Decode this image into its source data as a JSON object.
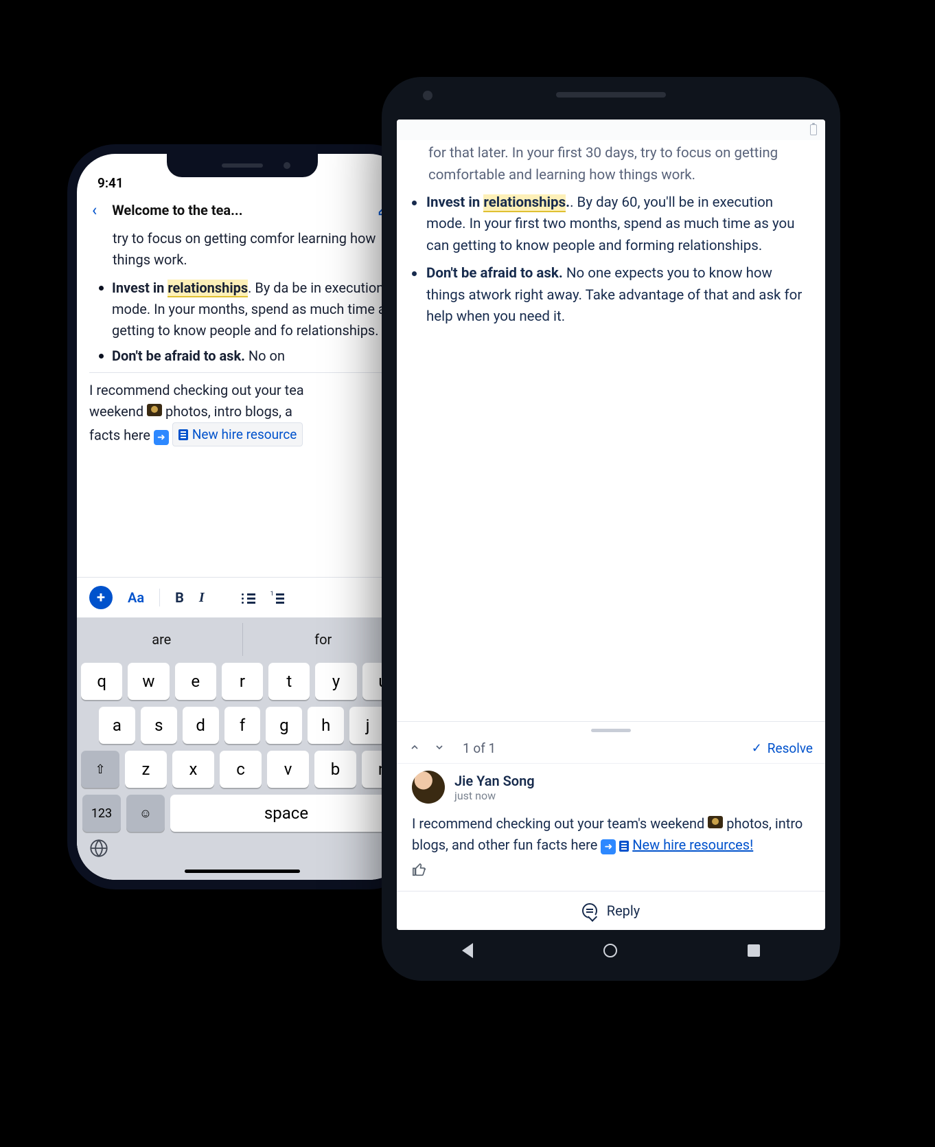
{
  "iphone": {
    "status_time": "9:41",
    "back_glyph": "‹",
    "title": "Welcome to the tea...",
    "content_top": "try to focus on getting comfor             learning how things work.",
    "bullet1_lead": "Invest in ",
    "bullet1_hl": "relationships",
    "bullet1_after": ". By da           be in execution mode. In your              months, spend as much time a                     getting to know people and fo                  relationships.",
    "bullet2_lead": "Don't be afraid to ask.",
    "bullet2_after": " No on",
    "rec_text_a": "I recommend checking out your tea",
    "rec_text_b": "weekend ",
    "rec_text_c": " photos, intro blogs, a",
    "rec_text_d": "facts here ",
    "chip_label": "New hire resource",
    "toolbar": {
      "Aa": "Aa",
      "bold": "B",
      "italic": "I"
    },
    "suggestions": [
      "are",
      "for"
    ],
    "rows": {
      "r1": [
        "q",
        "w",
        "e",
        "r",
        "t",
        "y",
        "u"
      ],
      "r2": [
        "a",
        "s",
        "d",
        "f",
        "g",
        "h",
        "j"
      ],
      "r3": [
        "z",
        "x",
        "c",
        "v",
        "b",
        "n"
      ]
    },
    "shift": "⇧",
    "num": "123",
    "emoji": "☺",
    "space": "space",
    "globe": "🌐"
  },
  "android": {
    "cutoff_text": "for that later. In your first 30 days, try to focus on getting comfortable and learning how things work.",
    "bullet1_lead": "Invest in ",
    "bullet1_hl": "relationships",
    "bullet1_after": ". By day 60, you'll be in execution mode. In your first two months, spend as much time as you can getting to know people and forming relationships.",
    "bullet2_lead": "Don't be afraid to ask.",
    "bullet2_after": " No one expects you to know how things atwork right away. Take advantage of that and ask for help when you need it.",
    "count": "1 of 1",
    "resolve": "Resolve",
    "author": "Jie Yan Song",
    "time": "just now",
    "comment_a": "I recommend checking out your team's weekend ",
    "comment_b": " photos, intro blogs, and other fun facts here ",
    "link_text": "New hire resources!",
    "reply": "Reply",
    "thumbs": "👍"
  }
}
